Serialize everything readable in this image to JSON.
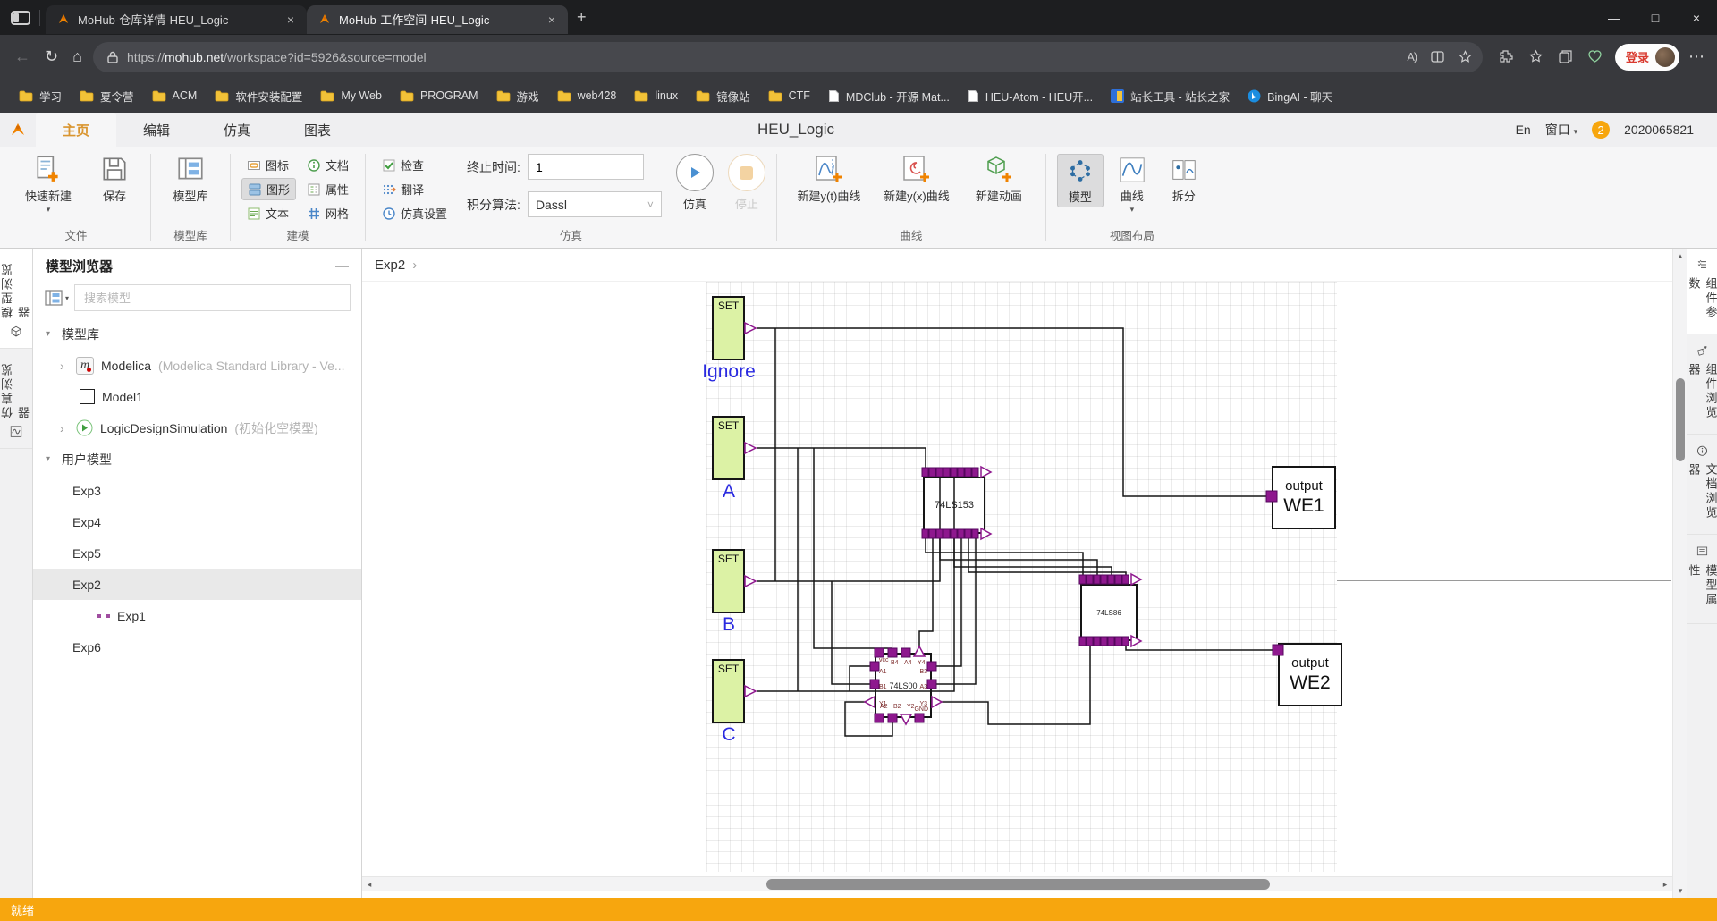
{
  "browser": {
    "tabs": [
      {
        "title": "MoHub-仓库详情-HEU_Logic"
      },
      {
        "title": "MoHub-工作空间-HEU_Logic"
      }
    ],
    "url": {
      "scheme": "https://",
      "host": "mohub.net",
      "path": "/workspace?id=5926&source=model"
    },
    "login_label": "登录",
    "bookmarks": [
      "学习",
      "夏令营",
      "ACM",
      "软件安装配置",
      "My Web",
      "PROGRAM",
      "游戏",
      "web428",
      "linux",
      "镜像站",
      "CTF",
      "MDClub - 开源 Mat...",
      "HEU-Atom - HEU开...",
      "站长工具 - 站长之家",
      "BingAI - 聊天"
    ]
  },
  "icons": {
    "back": "←",
    "refresh": "↻",
    "home": "⌂",
    "more": "⋯",
    "read_aloud": "A)",
    "close": "×",
    "new_tab": "+",
    "minimize": "—",
    "maximize": "□",
    "caret_down": "▾",
    "tree_open": "▾",
    "tree_closed": "›",
    "breadcrumb_chevron": "›",
    "select_chevron": "˅",
    "scroll_left": "◂",
    "scroll_right": "▸",
    "scroll_up": "▴",
    "scroll_down": "▾",
    "panel_minimize": "—"
  },
  "ribbon": {
    "tabs": [
      "主页",
      "编辑",
      "仿真",
      "图表"
    ],
    "title": "HEU_Logic",
    "right": {
      "lang": "En",
      "window": "窗口",
      "badge": "2",
      "user_id": "2020065821"
    },
    "groups": {
      "file": {
        "label": "文件",
        "quick_new": "快速新建",
        "save": "保存"
      },
      "library": {
        "label": "模型库",
        "library": "模型库"
      },
      "modeling": {
        "label": "建模",
        "icon": "图标",
        "diagram": "图形",
        "text": "文本",
        "doc": "文档",
        "props": "属性",
        "grid": "网格"
      },
      "sim": {
        "label": "仿真",
        "check": "检查",
        "translate": "翻译",
        "settings": "仿真设置",
        "stop_time_label": "终止时间:",
        "stop_time_value": "1",
        "algo_label": "积分算法:",
        "algo_value": "Dassl",
        "run": "仿真",
        "stop": "停止"
      },
      "curves": {
        "label": "曲线",
        "new_yt": "新建y(t)曲线",
        "new_yx": "新建y(x)曲线",
        "new_anim": "新建动画"
      },
      "layout": {
        "label": "视图布局",
        "model": "模型",
        "curve": "曲线",
        "split": "拆分"
      }
    }
  },
  "left_strip": {
    "tabs": [
      "模型浏览器",
      "仿真浏览器"
    ]
  },
  "right_strip": {
    "tabs": [
      "组件参数",
      "组件浏览器",
      "文档浏览器",
      "模型属性"
    ]
  },
  "sidebar": {
    "title": "模型浏览器",
    "search_placeholder": "搜索模型",
    "tree": [
      {
        "label": "模型库"
      },
      {
        "label": "Modelica",
        "note": "(Modelica Standard Library - Ve..."
      },
      {
        "label": "Model1"
      },
      {
        "label": "LogicDesignSimulation",
        "note": "(初始化空模型)"
      },
      {
        "label": "用户模型"
      },
      {
        "label": "Exp3"
      },
      {
        "label": "Exp4"
      },
      {
        "label": "Exp5"
      },
      {
        "label": "Exp2"
      },
      {
        "label": "Exp1"
      },
      {
        "label": "Exp6"
      }
    ]
  },
  "canvas": {
    "breadcrumb": "Exp2",
    "sets": [
      {
        "text": "SET",
        "label": "Ignore"
      },
      {
        "text": "SET",
        "label": "A"
      },
      {
        "text": "SET",
        "label": "B"
      },
      {
        "text": "SET",
        "label": "C"
      }
    ],
    "chips": [
      {
        "name": "74LS153"
      },
      {
        "name": "74LS86"
      },
      {
        "name": "74LS00",
        "pins": {
          "top": [
            "vcc",
            "B4",
            "A4",
            "Y4"
          ],
          "left": [
            "A1",
            "B1",
            "Y1"
          ],
          "right": [
            "B3",
            "A3",
            "Y3"
          ],
          "bottom": [
            "A2",
            "B2",
            "Y2",
            "GND"
          ]
        }
      }
    ],
    "outputs": [
      {
        "title": "output",
        "name": "WE1"
      },
      {
        "title": "output",
        "name": "WE2"
      }
    ]
  },
  "status": {
    "text": "就绪"
  },
  "colors": {
    "accent_orange": "#F7A60E",
    "pin_purple": "#8E188E",
    "set_fill": "#DCF2A5",
    "label_blue": "#2A2AE0",
    "active_tab_text": "#D9952F"
  }
}
